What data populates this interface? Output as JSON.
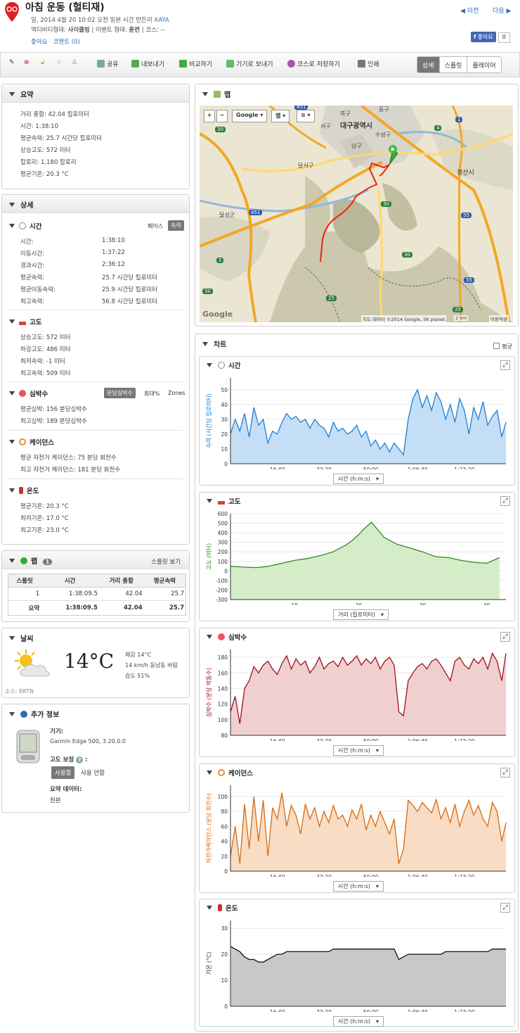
{
  "header": {
    "title": "아침 운동 (헐티재)",
    "meta_line1_prefix": "일, 2014 4월 20 10:02 오전 일본 시간 만든이",
    "author": "XAYA",
    "activity_type_label": "액티비티형태:",
    "activity_type": "사이클링",
    "event_type_label": "| 이벤트 형태:",
    "event_type": "훈련",
    "course_label": "| 코스:",
    "course": "--",
    "like_link": "좋아요",
    "comment_link": "코멘트 (0)",
    "prev": "◀ 이전",
    "next": "다음 ▶",
    "fb_like": "좋아요",
    "fb_count": "0"
  },
  "toolbar": {
    "share": "공유",
    "export": "내보내기",
    "compare": "비교하기",
    "send_device": "기기로 보내기",
    "save_course": "코스로 저장하기",
    "print": "인쇄",
    "view_detail": "상세",
    "view_split": "스플릿",
    "view_replay": "플레이어"
  },
  "summary": {
    "title": "요약",
    "rows": [
      "거리 총합: 42.04 킬로미터",
      "시간: 1:38:10",
      "평균속력: 25.7 시간당 킬로미터",
      "상승고도: 572 미터",
      "칼로리: 1,180 칼로리",
      "평균기온: 20.3 °C"
    ]
  },
  "detail": {
    "title": "상세",
    "time": {
      "title": "시간",
      "toggle_pace": "페이스",
      "toggle_speed": "속력",
      "rows": [
        {
          "label": "시간:",
          "value": "1:38:10"
        },
        {
          "label": "이동시간:",
          "value": "1:37:22"
        },
        {
          "label": "경과시간:",
          "value": "2:36:12"
        },
        {
          "label": "평균속력:",
          "value": "25.7 시간당 킬로미터"
        },
        {
          "label": "평균이동속력:",
          "value": "25.9 시간당 킬로미터"
        },
        {
          "label": "최고속력:",
          "value": "56.8 시간당 킬로미터"
        }
      ]
    },
    "elevation": {
      "title": "고도",
      "rows": [
        "상승고도: 572 미터",
        "하강고도: 486 미터",
        "최저속력: -1 미터",
        "최고속력: 509 미터"
      ]
    },
    "heart": {
      "title": "심박수",
      "toggle_bpm": "분당심박수",
      "toggle_max": "최대%",
      "toggle_zones": "Zones",
      "rows": [
        "평균심박: 156 분당심박수",
        "최고심박: 189 분당심박수"
      ]
    },
    "cadence": {
      "title": "케이던스",
      "rows": [
        "평균 자전거 케이던스: 75 분당 회전수",
        "최고 자전거 케이던스: 181 분당 회전수"
      ]
    },
    "temp": {
      "title": "온도",
      "rows": [
        "평균기온: 20.3 °C",
        "최저기온: 17.0 °C",
        "최고기온: 23.0 °C"
      ]
    }
  },
  "laps": {
    "title": "랩",
    "count": "1",
    "split_view": "스플릿 보기",
    "headers": [
      "스플릿",
      "시간",
      "거리 총합",
      "평균속력"
    ],
    "row": [
      "1",
      "1:38:09.5",
      "42.04",
      "25.7"
    ],
    "summary_row": [
      "요약",
      "1:38:09.5",
      "42.04",
      "25.7"
    ]
  },
  "weather": {
    "title": "날씨",
    "temp": "14°C",
    "feels": "체감 14°C",
    "wind": "14 km/h 동남동 바람",
    "humidity": "습도 51%",
    "source": "소스: RKTN"
  },
  "extra": {
    "title": "추가 정보",
    "device_label": "기기:",
    "device": "Garmin Edge 500, 3.20.0.0",
    "elev_corr_label": "고도 보정",
    "elev_corr_colon": ":",
    "use_btn": "사용함",
    "nouse": "사용 안함",
    "summary_data_label": "요약 데이터:",
    "summary_data": "원본"
  },
  "map": {
    "title": "맵",
    "zoom_in": "+",
    "zoom_out": "−",
    "type_google": "Google",
    "type_map": "맵",
    "labels": [
      "대구광역시",
      "북구",
      "서구",
      "남구",
      "수성구",
      "달서구",
      "달성군",
      "경산시",
      "동구"
    ],
    "road_labels": [
      "30",
      "451",
      "451",
      "55",
      "25",
      "5",
      "30",
      "30",
      "1",
      "4",
      "55",
      "30",
      "25"
    ],
    "attribution": "지도 데이터 ©2014 Google, SK planet",
    "scale": "2 km",
    "terms": "이용약관",
    "logo": "Google"
  },
  "charts": {
    "title": "차트",
    "avg_label": "평균",
    "time_axis": "시간 (h:m:s)",
    "dist_axis": "거리 (킬로미터)"
  },
  "chart_data": [
    {
      "type": "area",
      "title": "시간",
      "ylabel": "속력 (시간당 킬로미터)",
      "xlabel": "시간 (h:m:s)",
      "x_ticks": [
        "16:40",
        "33:20",
        "50:00",
        "1:06:40",
        "1:23:20"
      ],
      "x_tick_seconds": [
        1000,
        2000,
        3000,
        4000,
        5000
      ],
      "y_ticks": [
        0,
        10,
        20,
        30,
        40,
        50
      ],
      "ylim": [
        0,
        58
      ],
      "xlim_seconds": [
        0,
        5890
      ],
      "color": "#1f7fd6",
      "fill": "#c4dff5",
      "x_seconds": [
        0,
        100,
        200,
        300,
        400,
        500,
        600,
        700,
        800,
        900,
        1000,
        1100,
        1200,
        1300,
        1400,
        1500,
        1600,
        1700,
        1800,
        1900,
        2000,
        2100,
        2200,
        2300,
        2400,
        2500,
        2600,
        2700,
        2800,
        2900,
        3000,
        3100,
        3200,
        3300,
        3400,
        3500,
        3600,
        3700,
        3800,
        3900,
        4000,
        4100,
        4200,
        4300,
        4400,
        4500,
        4600,
        4700,
        4800,
        4900,
        5000,
        5100,
        5200,
        5300,
        5400,
        5500,
        5600,
        5700,
        5800,
        5890
      ],
      "values": [
        20,
        30,
        22,
        34,
        18,
        38,
        26,
        30,
        14,
        22,
        20,
        28,
        34,
        30,
        32,
        28,
        30,
        24,
        30,
        26,
        24,
        18,
        28,
        22,
        24,
        20,
        22,
        26,
        18,
        22,
        12,
        16,
        10,
        14,
        8,
        14,
        10,
        6,
        30,
        44,
        50,
        38,
        46,
        36,
        48,
        42,
        30,
        40,
        28,
        44,
        36,
        20,
        38,
        30,
        42,
        26,
        32,
        36,
        18,
        28
      ]
    },
    {
      "type": "area",
      "title": "고도",
      "ylabel": "고도 (미터)",
      "xlabel": "거리 (킬로미터)",
      "x_ticks": [
        10,
        20,
        30,
        40
      ],
      "y_ticks": [
        600,
        500,
        400,
        300,
        200,
        100,
        0,
        -100,
        -200,
        -300
      ],
      "ylim": [
        -300,
        600
      ],
      "xlim": [
        0,
        43
      ],
      "color": "#2e8b1f",
      "fill": "#d4ecc8",
      "x": [
        0,
        2,
        4,
        6,
        8,
        10,
        12,
        14,
        16,
        18,
        19,
        20,
        21,
        22,
        23,
        24,
        26,
        28,
        30,
        32,
        34,
        36,
        38,
        40,
        42
      ],
      "values": [
        50,
        40,
        35,
        50,
        80,
        110,
        130,
        160,
        200,
        270,
        320,
        380,
        450,
        510,
        430,
        350,
        280,
        240,
        200,
        150,
        140,
        110,
        90,
        80,
        140
      ]
    },
    {
      "type": "area",
      "title": "심박수",
      "ylabel": "심박수 (분당 박동수)",
      "xlabel": "시간 (h:m:s)",
      "x_ticks": [
        "16:40",
        "33:20",
        "50:00",
        "1:06:40",
        "1:23:20"
      ],
      "x_tick_seconds": [
        1000,
        2000,
        3000,
        4000,
        5000
      ],
      "y_ticks": [
        80,
        100,
        120,
        140,
        160,
        180
      ],
      "ylim": [
        80,
        190
      ],
      "xlim_seconds": [
        0,
        5890
      ],
      "color": "#a0101c",
      "fill": "#f0cfcf",
      "x_seconds": [
        0,
        100,
        200,
        300,
        400,
        500,
        600,
        700,
        800,
        900,
        1000,
        1100,
        1200,
        1300,
        1400,
        1500,
        1600,
        1700,
        1800,
        1900,
        2000,
        2100,
        2200,
        2300,
        2400,
        2500,
        2600,
        2700,
        2800,
        2900,
        3000,
        3100,
        3200,
        3300,
        3400,
        3500,
        3600,
        3700,
        3800,
        3900,
        4000,
        4100,
        4200,
        4300,
        4400,
        4500,
        4600,
        4700,
        4800,
        4900,
        5000,
        5100,
        5200,
        5300,
        5400,
        5500,
        5600,
        5700,
        5800,
        5890
      ],
      "values": [
        110,
        130,
        95,
        140,
        150,
        168,
        160,
        170,
        175,
        165,
        158,
        172,
        182,
        165,
        178,
        170,
        175,
        160,
        168,
        180,
        165,
        172,
        175,
        168,
        180,
        170,
        175,
        182,
        170,
        178,
        172,
        180,
        165,
        175,
        180,
        170,
        110,
        105,
        150,
        160,
        168,
        172,
        165,
        175,
        178,
        170,
        160,
        150,
        175,
        180,
        170,
        165,
        178,
        172,
        180,
        165,
        185,
        175,
        150,
        185
      ]
    },
    {
      "type": "area",
      "title": "케이던스",
      "ylabel": "자전거케이던스 (분당 회전수)",
      "xlabel": "시간 (h:m:s)",
      "x_ticks": [
        "16:40",
        "33:20",
        "50:00",
        "1:06:40",
        "1:23:20"
      ],
      "x_tick_seconds": [
        1000,
        2000,
        3000,
        4000,
        5000
      ],
      "y_ticks": [
        0,
        20,
        40,
        60,
        80,
        100
      ],
      "ylim": [
        0,
        115
      ],
      "xlim_seconds": [
        0,
        5890
      ],
      "color": "#d86b10",
      "fill": "#f8dcc4",
      "x_seconds": [
        0,
        100,
        200,
        300,
        400,
        500,
        600,
        700,
        800,
        900,
        1000,
        1100,
        1200,
        1300,
        1400,
        1500,
        1600,
        1700,
        1800,
        1900,
        2000,
        2100,
        2200,
        2300,
        2400,
        2500,
        2600,
        2700,
        2800,
        2900,
        3000,
        3100,
        3200,
        3300,
        3400,
        3500,
        3600,
        3700,
        3800,
        3900,
        4000,
        4100,
        4200,
        4300,
        4400,
        4500,
        4600,
        4700,
        4800,
        4900,
        5000,
        5100,
        5200,
        5300,
        5400,
        5500,
        5600,
        5700,
        5800,
        5890
      ],
      "values": [
        20,
        60,
        10,
        90,
        30,
        100,
        40,
        95,
        20,
        85,
        70,
        105,
        60,
        88,
        75,
        50,
        90,
        70,
        85,
        60,
        80,
        65,
        88,
        70,
        75,
        60,
        82,
        70,
        90,
        55,
        75,
        60,
        80,
        65,
        50,
        70,
        10,
        30,
        95,
        88,
        80,
        92,
        85,
        78,
        96,
        70,
        85,
        65,
        90,
        60,
        80,
        95,
        75,
        88,
        70,
        60,
        92,
        80,
        40,
        65
      ]
    },
    {
      "type": "area",
      "title": "온도",
      "ylabel": "기온 (°C)",
      "xlabel": "시간 (h:m:s)",
      "x_ticks": [
        "16:40",
        "33:20",
        "50:00",
        "1:06:40",
        "1:23:20"
      ],
      "x_tick_seconds": [
        1000,
        2000,
        3000,
        4000,
        5000
      ],
      "y_ticks": [
        0,
        10,
        20,
        30
      ],
      "ylim": [
        0,
        33
      ],
      "xlim_seconds": [
        0,
        5890
      ],
      "color": "#111111",
      "fill": "#c8c8c8",
      "x_seconds": [
        0,
        100,
        200,
        300,
        400,
        500,
        600,
        700,
        800,
        900,
        1000,
        1100,
        1200,
        1300,
        1400,
        1500,
        1600,
        1700,
        1800,
        1900,
        2000,
        2100,
        2200,
        2300,
        2400,
        2500,
        2600,
        2700,
        2800,
        2900,
        3000,
        3100,
        3200,
        3300,
        3400,
        3500,
        3600,
        3700,
        3800,
        3900,
        4000,
        4100,
        4200,
        4300,
        4400,
        4500,
        4600,
        4700,
        4800,
        4900,
        5000,
        5100,
        5200,
        5300,
        5400,
        5500,
        5600,
        5700,
        5800,
        5890
      ],
      "values": [
        23,
        22,
        21,
        19,
        18,
        18,
        17,
        17,
        18,
        19,
        20,
        20,
        21,
        21,
        21,
        21,
        21,
        21,
        21,
        21,
        21,
        21,
        22,
        22,
        22,
        22,
        22,
        22,
        22,
        22,
        22,
        22,
        22,
        22,
        22,
        22,
        18,
        19,
        20,
        20,
        20,
        20,
        20,
        20,
        20,
        20,
        21,
        21,
        21,
        21,
        21,
        21,
        21,
        21,
        21,
        21,
        22,
        22,
        22,
        22
      ]
    }
  ]
}
